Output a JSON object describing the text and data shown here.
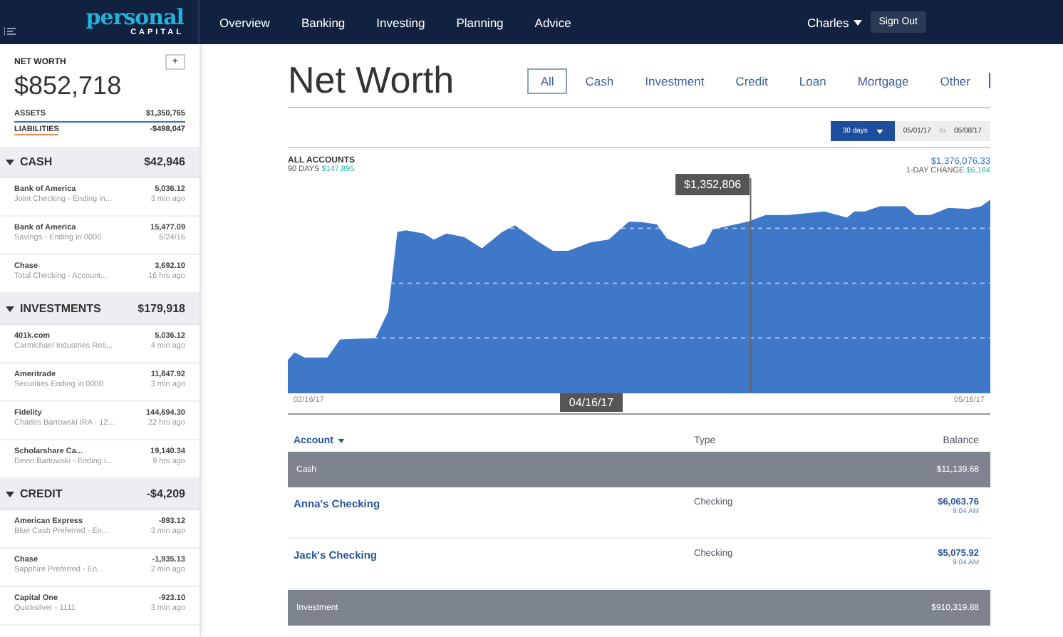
{
  "logo": {
    "word": "personal",
    "sub": "CAPITAL"
  },
  "nav": {
    "items": [
      {
        "label": "Overview"
      },
      {
        "label": "Banking"
      },
      {
        "label": "Investing"
      },
      {
        "label": "Planning"
      },
      {
        "label": "Advice"
      }
    ],
    "user": "Charles",
    "sign_out": "Sign Out"
  },
  "net_worth": {
    "label": "NET WORTH",
    "add": "+",
    "value": "$852,718",
    "assets_label": "ASSETS",
    "assets": "$1,350,765",
    "liabilities_label": "LIABILITIES",
    "liabilities": "-$498,047"
  },
  "sections": [
    {
      "label": "CASH",
      "total": "$42,946",
      "expanded": true,
      "accounts": [
        {
          "name": "Bank of America",
          "detail": "Joint Checking - Ending in...",
          "amount": "5,036.12",
          "time": "3 min ago"
        },
        {
          "name": "Bank of America",
          "detail": "Savings - Ending in 0000",
          "amount": "15,477.09",
          "time": "6/24/16"
        },
        {
          "name": "Chase",
          "detail": "Total Checking - Account...",
          "amount": "3,692.10",
          "time": "16 hrs ago"
        }
      ]
    },
    {
      "label": "INVESTMENTS",
      "total": "$179,918",
      "expanded": true,
      "accounts": [
        {
          "name": "401k.com",
          "detail": "Carmichael Industries Reti...",
          "amount": "5,036.12",
          "time": "4 min ago"
        },
        {
          "name": "Ameritrade",
          "detail": "Securities Ending in 0000",
          "amount": "11,847.92",
          "time": "3 min ago"
        },
        {
          "name": "Fidelity",
          "detail": "Charles Bartowski IRA - 12...",
          "amount": "144,694.30",
          "time": "22 hrs ago"
        },
        {
          "name": "Scholarshare Ca...",
          "detail": "Devin Bartowski - Ending i...",
          "amount": "19,140.34",
          "time": "9 hrs ago"
        }
      ]
    },
    {
      "label": "CREDIT",
      "total": "-$4,209",
      "expanded": true,
      "accounts": [
        {
          "name": "American Express",
          "detail": "Blue Cash Preferred - En...",
          "amount": "-893.12",
          "time": "3 min ago"
        },
        {
          "name": "Chase",
          "detail": "Sapphire Preferred - En...",
          "amount": "-1,935.13",
          "time": "2 min ago"
        },
        {
          "name": "Capital One",
          "detail": "Quicksilver - 1111",
          "amount": "-923.10",
          "time": "3 min ago"
        }
      ]
    }
  ],
  "page": {
    "title": "Net Worth",
    "tabs": [
      {
        "label": "All",
        "selected": true
      },
      {
        "label": "Cash",
        "selected": false
      },
      {
        "label": "Investment",
        "selected": false
      },
      {
        "label": "Credit",
        "selected": false
      },
      {
        "label": "Loan",
        "selected": false
      },
      {
        "label": "Mortgage",
        "selected": false
      },
      {
        "label": "Other",
        "selected": false
      }
    ]
  },
  "range": {
    "period": "30 days",
    "from": "05/01/17",
    "to_word": "to",
    "to": "05/08/17"
  },
  "chart": {
    "title": "ALL ACCOUNTS",
    "period_label": "90 DAYS",
    "period_change": "$147,895",
    "total": "$1,376,076.33",
    "day_label": "1-DAY CHANGE",
    "day_change": "$6,184",
    "tooltip_value": "$1,352,806",
    "tooltip_date": "04/16/17",
    "x_start": "02/16/17",
    "x_end": "05/16/17"
  },
  "table": {
    "columns": [
      "Account",
      "Type",
      "Balance"
    ],
    "rows": [
      {
        "kind": "group",
        "name": "Cash",
        "balance": "$11,139.68"
      },
      {
        "kind": "account",
        "name": "Anna's Checking",
        "type": "Checking",
        "balance": "$6,063.76",
        "time": "9:04 AM"
      },
      {
        "kind": "account",
        "name": "Jack's Checking",
        "type": "Checking",
        "balance": "$5,075.92",
        "time": "9:04 AM"
      },
      {
        "kind": "group",
        "name": "Investment",
        "balance": "$910,319.88"
      }
    ]
  }
}
